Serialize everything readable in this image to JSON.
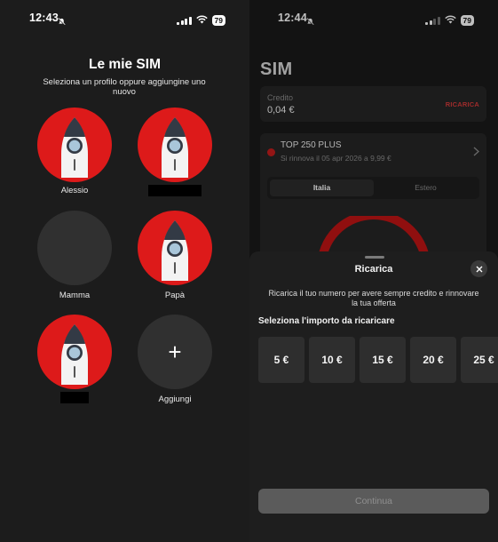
{
  "left_screen": {
    "status": {
      "time": "12:43",
      "battery": "79"
    },
    "title": "Le mie SIM",
    "subtitle": "Seleziona un profilo oppure aggiungine uno nuovo",
    "profiles": [
      {
        "name": "Alessio",
        "avatar": "rocket-icon",
        "redacted": false
      },
      {
        "name": "",
        "avatar": "rocket-icon",
        "redacted": true
      },
      {
        "name": "Mamma",
        "avatar": "empty",
        "redacted": false
      },
      {
        "name": "Papà",
        "avatar": "rocket-icon",
        "redacted": false
      },
      {
        "name": "",
        "avatar": "rocket-icon",
        "redacted": true
      },
      {
        "name": "Aggiungi",
        "avatar": "plus-icon",
        "redacted": false
      }
    ]
  },
  "right_screen": {
    "status": {
      "time": "12:44",
      "battery": "79"
    },
    "page_title": "SIM",
    "credit": {
      "label": "Credito",
      "value": "0,04 €",
      "action": "RICARICA"
    },
    "offer": {
      "name": "TOP 250 PLUS",
      "renewal": "Si rinnova il 05 apr 2026 a 9,99 €",
      "tabs": [
        "Italia",
        "Estero"
      ],
      "active_tab": "Italia"
    },
    "sheet": {
      "title": "Ricarica",
      "description": "Ricarica il tuo numero per avere sempre credito e rinnovare la tua offerta",
      "prompt": "Seleziona l'importo da ricaricare",
      "amounts": [
        "5 €",
        "10 €",
        "15 €",
        "20 €",
        "25 €"
      ],
      "continue_label": "Continua"
    }
  },
  "colors": {
    "brand_red": "#dd1a1a",
    "link_red": "#d53a3a",
    "background": "#1c1c1c",
    "card": "#262626"
  }
}
